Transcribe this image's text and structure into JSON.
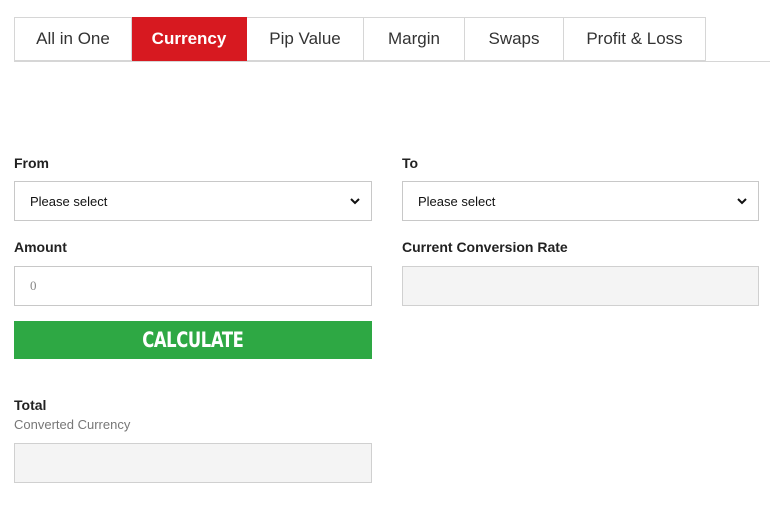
{
  "tabs": [
    {
      "label": "All in One",
      "active": false
    },
    {
      "label": "Currency",
      "active": true
    },
    {
      "label": "Pip Value",
      "active": false
    },
    {
      "label": "Margin",
      "active": false
    },
    {
      "label": "Swaps",
      "active": false
    },
    {
      "label": "Profit & Loss",
      "active": false
    }
  ],
  "form": {
    "from_label": "From",
    "from_value": "Please select",
    "to_label": "To",
    "to_value": "Please select",
    "amount_label": "Amount",
    "amount_placeholder": "0",
    "rate_label": "Current Conversion Rate",
    "rate_value": "",
    "calculate_label": "CALCULATE",
    "total_label": "Total",
    "total_sublabel": "Converted Currency",
    "total_value": ""
  },
  "colors": {
    "active_tab": "#d71920",
    "calculate_button": "#2ea844",
    "readonly_field": "#f4f4f4"
  },
  "icons": {
    "select_arrow": "chevron-down-icon"
  }
}
